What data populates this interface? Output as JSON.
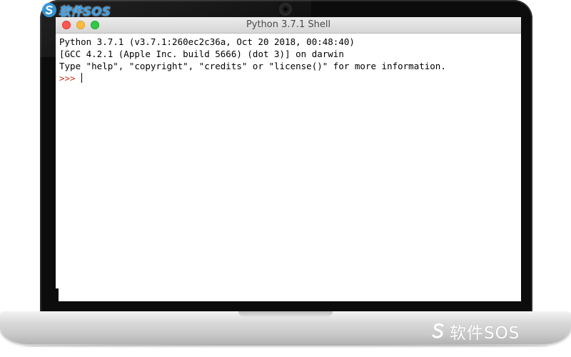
{
  "window": {
    "title": "Python 3.7.1 Shell",
    "buttons": {
      "close_color": "#fc5753",
      "minimize_color": "#fdbc40",
      "maximize_color": "#33c748"
    }
  },
  "shell": {
    "banner": [
      "Python 3.7.1 (v3.7.1:260ec2c36a, Oct 20 2018, 00:48:40)",
      "[GCC 4.2.1 (Apple Inc. build 5666) (dot 3)] on darwin",
      "Type \"help\", \"copyright\", \"credits\" or \"license()\" for more information."
    ],
    "prompt": ">>> ",
    "prompt_color": "#c2341f"
  },
  "watermark": {
    "top": "软件SOS",
    "bottom": "软件SOS",
    "top_color": "#3a9ee6"
  }
}
